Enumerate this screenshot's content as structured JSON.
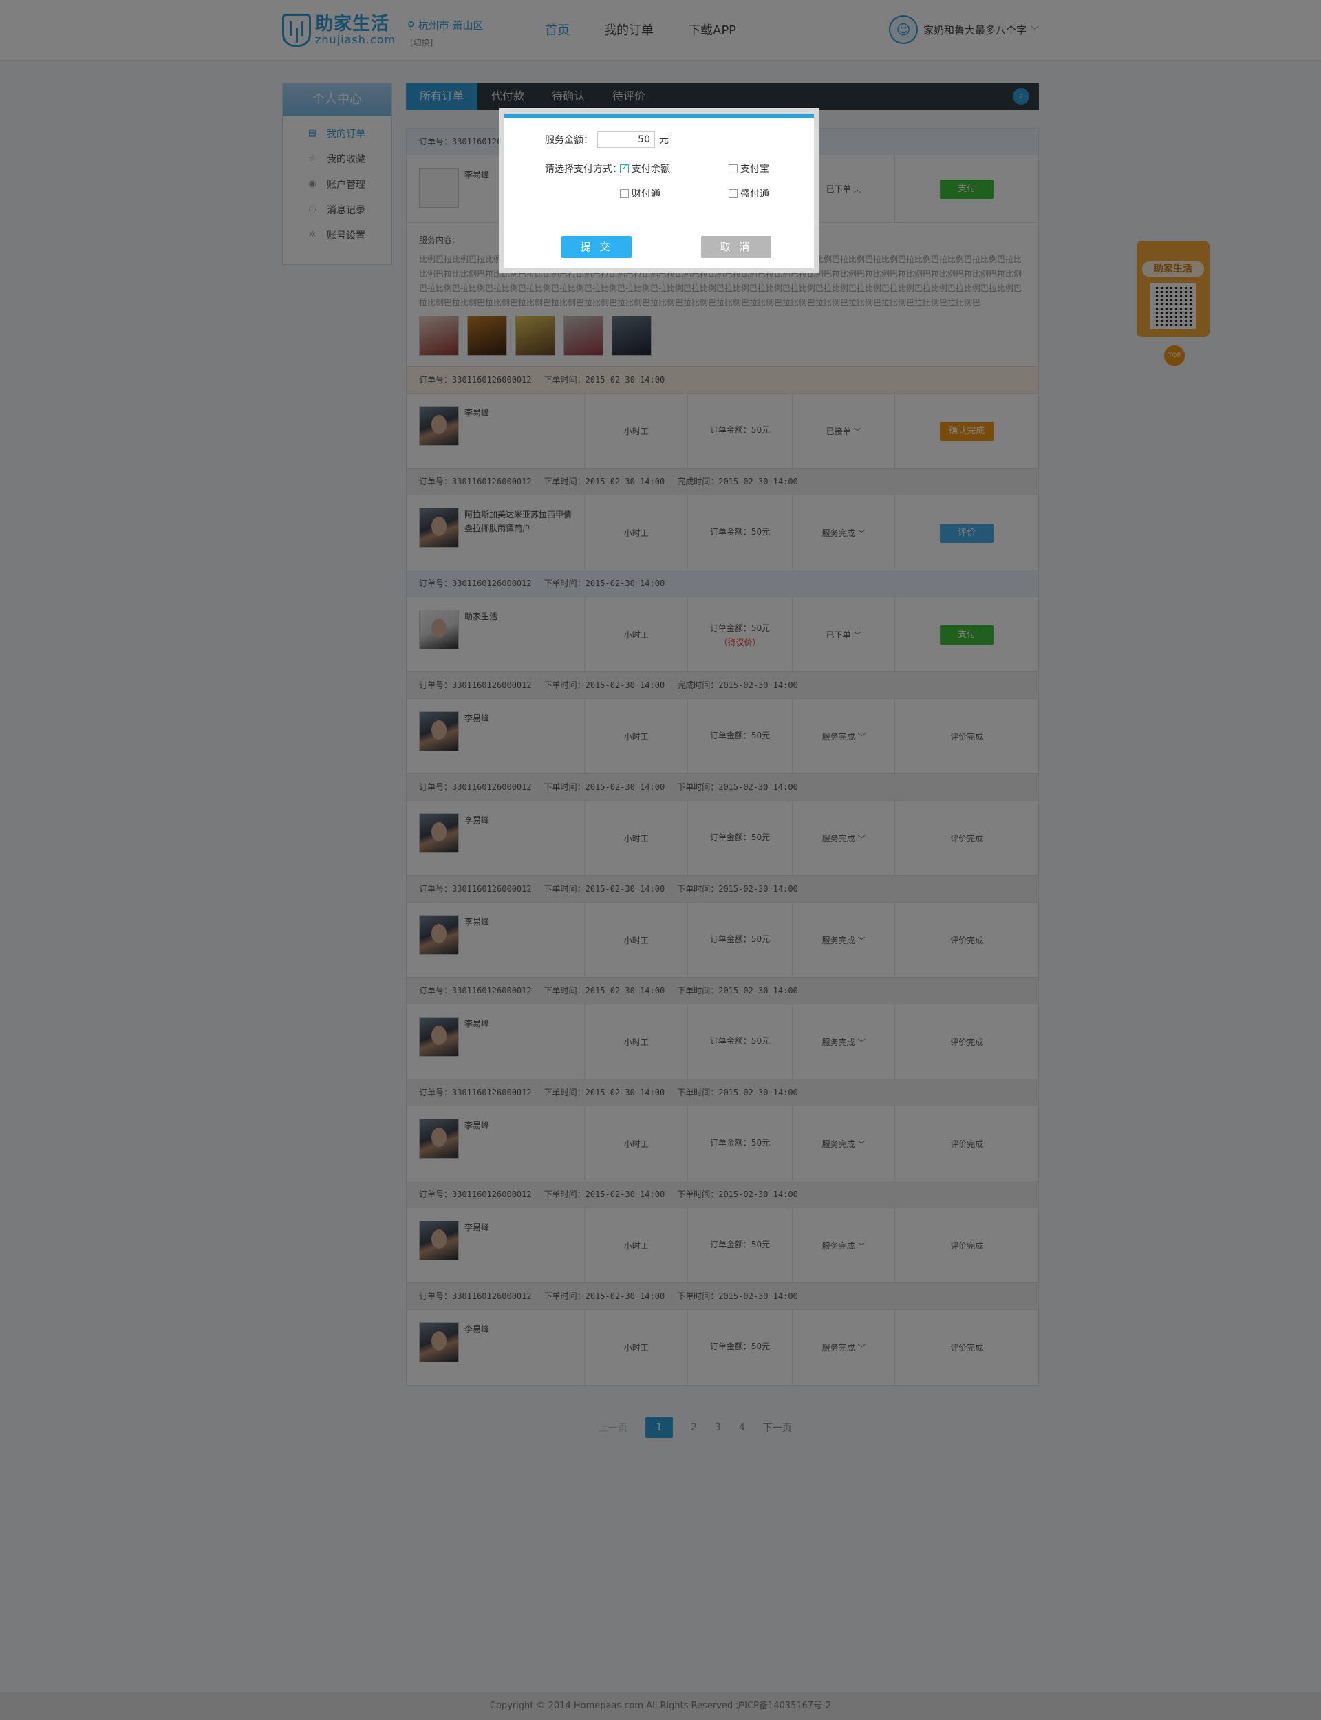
{
  "header": {
    "logo_cn": "助家生活",
    "logo_en": "zhujiash.com",
    "city": "杭州市·萧山区",
    "switch": "[切换]",
    "nav": [
      "首页",
      "我的订单",
      "下载APP"
    ],
    "username": "家奶和鲁大最多八个字"
  },
  "sidebar": {
    "title": "个人中心",
    "items": [
      {
        "label": "我的订单",
        "icon": "document-icon"
      },
      {
        "label": "我的收藏",
        "icon": "star-icon"
      },
      {
        "label": "账户管理",
        "icon": "target-icon"
      },
      {
        "label": "消息记录",
        "icon": "chat-icon"
      },
      {
        "label": "账号设置",
        "icon": "gear-icon"
      }
    ]
  },
  "tabs": [
    "所有订单",
    "代付款",
    "待确认",
    "待评价"
  ],
  "first_order": {
    "id_label": "订单号：3301160126000012",
    "name": "李易峰",
    "status": "已下单",
    "button": "支付",
    "service_label": "服务内容:",
    "service_text": "比例巴拉比例巴拉比例巴拉比例巴拉比例巴拉比例巴拉比例巴拉比例巴拉比例巴拉比例巴拉比例巴拉比例巴拉比例巴拉比例巴拉比例巴拉比例巴拉比例巴拉比例巴拉比比例巴拉比比例巴拉比比例巴拉比比例巴拉比例巴拉比例巴拉比例巴拉比例巴拉比例巴拉比例巴拉比例巴拉比例巴拉比例巴拉比例巴拉比例巴拉比例巴拉比例巴拉比例巴拉比例巴拉比例巴拉比例巴拉比例巴拉比例巴拉比例巴拉比例巴拉比例巴拉比例巴拉比例巴拉比例巴拉比例巴拉比例巴拉比例巴拉比例巴拉比例巴拉比例巴拉比例巴拉比例巴拉比例巴拉比例巴拉比例巴拉比例巴拉比例巴拉比例巴拉比例巴拉比例巴拉比例巴拉比例巴拉比例巴拉比例巴拉比例巴拉比例巴拉比例巴拉比例巴"
  },
  "orders": [
    {
      "id": "订单号：3301160126000012",
      "t1": "下单时间：2015-02-30  14:00",
      "t2": "",
      "name": "李易峰",
      "type": "小时工",
      "amount": "订单金额：50元",
      "extra": "",
      "status": "已接单",
      "action": "确认完成",
      "action_style": "orange",
      "head": "orange",
      "pic": "photo"
    },
    {
      "id": "订单号：3301160126000012",
      "t1": "下单时间：2015-02-30  14:00",
      "t2": "完成时间：2015-02-30  14:00",
      "name": "阿拉斯加美达米亚苏拉西甲倩盎拉揶肤雨谭苘户",
      "type": "小时工",
      "amount": "订单金额：50元",
      "extra": "",
      "status": "服务完成",
      "action": "评价",
      "action_style": "blue",
      "head": "gray",
      "pic": "photo"
    },
    {
      "id": "订单号：3301160126000012",
      "t1": "下单时间：2015-02-30  14:00",
      "t2": "",
      "name": "助家生活",
      "type": "小时工",
      "amount": "订单金额：50元",
      "extra": "（待议价）",
      "status": "已下单",
      "action": "支付",
      "action_style": "green",
      "head": "blue",
      "pic": "light"
    },
    {
      "id": "订单号：3301160126000012",
      "t1": "下单时间：2015-02-30  14:00",
      "t2": "完成时间：2015-02-30  14:00",
      "name": "李易峰",
      "type": "小时工",
      "amount": "订单金额：50元",
      "extra": "",
      "status": "服务完成",
      "action": "评价完成",
      "action_style": "text",
      "head": "gray",
      "pic": "photo"
    },
    {
      "id": "订单号：3301160126000012",
      "t1": "下单时间：2015-02-30  14:00",
      "t2": "下单时间：2015-02-30  14:00",
      "name": "李易峰",
      "type": "小时工",
      "amount": "订单金额：50元",
      "extra": "",
      "status": "服务完成",
      "action": "评价完成",
      "action_style": "text",
      "head": "gray",
      "pic": "photo"
    },
    {
      "id": "订单号：3301160126000012",
      "t1": "下单时间：2015-02-30  14:00",
      "t2": "下单时间：2015-02-30  14:00",
      "name": "李易峰",
      "type": "小时工",
      "amount": "订单金额：50元",
      "extra": "",
      "status": "服务完成",
      "action": "评价完成",
      "action_style": "text",
      "head": "gray",
      "pic": "photo"
    },
    {
      "id": "订单号：3301160126000012",
      "t1": "下单时间：2015-02-30  14:00",
      "t2": "下单时间：2015-02-30  14:00",
      "name": "李易峰",
      "type": "小时工",
      "amount": "订单金额：50元",
      "extra": "",
      "status": "服务完成",
      "action": "评价完成",
      "action_style": "text",
      "head": "gray",
      "pic": "photo"
    },
    {
      "id": "订单号：3301160126000012",
      "t1": "下单时间：2015-02-30  14:00",
      "t2": "下单时间：2015-02-30  14:00",
      "name": "李易峰",
      "type": "小时工",
      "amount": "订单金额：50元",
      "extra": "",
      "status": "服务完成",
      "action": "评价完成",
      "action_style": "text",
      "head": "gray",
      "pic": "photo"
    },
    {
      "id": "订单号：3301160126000012",
      "t1": "下单时间：2015-02-30  14:00",
      "t2": "下单时间：2015-02-30  14:00",
      "name": "李易峰",
      "type": "小时工",
      "amount": "订单金额：50元",
      "extra": "",
      "status": "服务完成",
      "action": "评价完成",
      "action_style": "text",
      "head": "gray",
      "pic": "photo"
    },
    {
      "id": "订单号：3301160126000012",
      "t1": "下单时间：2015-02-30  14:00",
      "t2": "下单时间：2015-02-30  14:00",
      "name": "李易峰",
      "type": "小时工",
      "amount": "订单金额：50元",
      "extra": "",
      "status": "服务完成",
      "action": "评价完成",
      "action_style": "text",
      "head": "gray",
      "pic": "photo"
    }
  ],
  "pagination": {
    "prev": "上一页",
    "pages": [
      "1",
      "2",
      "3",
      "4"
    ],
    "current": "1",
    "next": "下一页"
  },
  "float_widget": {
    "title": "助家生活",
    "top": "TOP"
  },
  "footer": "Copyright © 2014 Homepaas.com  All Rights Reserved  沪ICP备14035167号-2",
  "modal": {
    "amount_label": "服务金额：",
    "amount_value": "50",
    "unit": "元",
    "pay_label": "请选择支付方式：",
    "options": [
      {
        "label": "支付余额",
        "checked": true
      },
      {
        "label": "支付宝",
        "checked": false
      },
      {
        "label": "财付通",
        "checked": false
      },
      {
        "label": "盛付通",
        "checked": false
      }
    ],
    "submit": "提 交",
    "cancel": "取 消"
  },
  "colors": {
    "accent": "#2e9fd8",
    "green": "#3ec13e",
    "orange": "#f19716",
    "nav_dark": "#333d47"
  }
}
